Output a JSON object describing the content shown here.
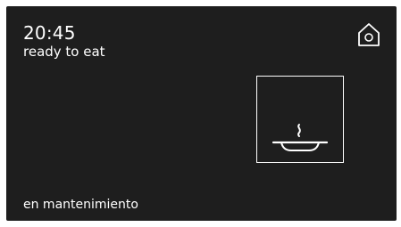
{
  "header": {
    "time": "20:45",
    "status": "ready to eat"
  },
  "home_button": {
    "icon": "home-icon"
  },
  "dish": {
    "icon": "steaming-plate-icon"
  },
  "footer": {
    "mode": "en mantenimiento"
  },
  "colors": {
    "background": "#1e1e1e",
    "foreground": "#ffffff",
    "bezel": "#ffffff"
  }
}
